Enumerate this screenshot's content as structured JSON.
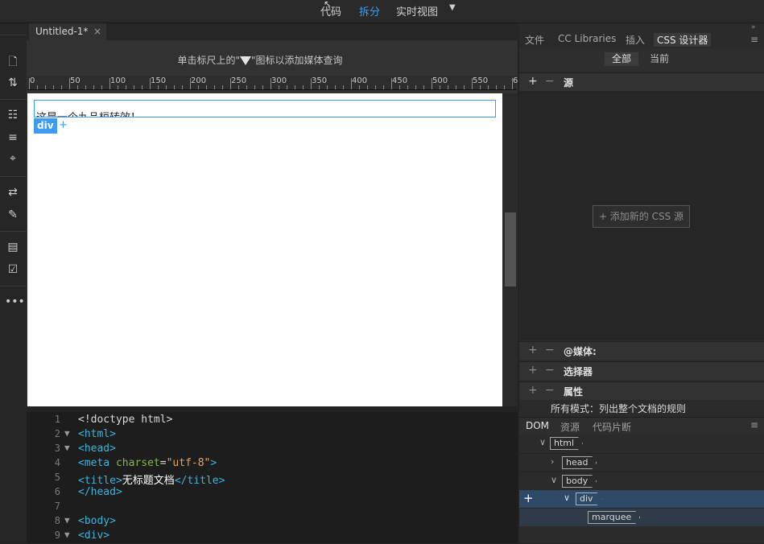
{
  "view_switcher": {
    "code": "代码",
    "split": "拆分",
    "live": "实时视图",
    "dropdown_icon": "caret-down-icon"
  },
  "document": {
    "tab_title": "Untitled-1*",
    "close_glyph": "×"
  },
  "design_view": {
    "media_query_hint_pre": "单击标尺上的\"",
    "media_query_hint_post": "\"图标以添加媒体查询",
    "ruler_labels": [
      "0",
      "50",
      "100",
      "150",
      "200",
      "250",
      "300",
      "350",
      "400",
      "450",
      "500",
      "550",
      "6"
    ],
    "selected_text": "这是一个九品桓转效！",
    "element_tag": "div",
    "add_glyph": "+"
  },
  "code_view": {
    "lines": [
      {
        "n": "1",
        "fold": ""
      },
      {
        "n": "2",
        "fold": "▼"
      },
      {
        "n": "3",
        "fold": "▼"
      },
      {
        "n": "4",
        "fold": ""
      },
      {
        "n": "5",
        "fold": ""
      },
      {
        "n": "6",
        "fold": ""
      },
      {
        "n": "7",
        "fold": ""
      },
      {
        "n": "8",
        "fold": "▼"
      },
      {
        "n": "9",
        "fold": "▼"
      }
    ],
    "doctype": "<!doctype html>",
    "html_open": "<html>",
    "head_open": "<head>",
    "meta_open": "<meta",
    "meta_attr": "charset",
    "meta_eq": "=",
    "meta_val": "\"utf-8\"",
    "meta_close": ">",
    "title_open": "<title>",
    "title_text": "无标题文档",
    "title_close": "</title>",
    "head_close": "</head>",
    "body_open": "<body>",
    "div_open": "<div>"
  },
  "right_panel": {
    "tabs": [
      "文件",
      "CC Libraries",
      "插入",
      "CSS 设计器"
    ],
    "filter_all": "全部",
    "filter_current": "当前",
    "sources_title": "源",
    "add_source_button": "+ 添加新的 CSS 源",
    "media_title": "@媒体:",
    "selectors_title": "选择器",
    "properties_title": "属性",
    "mode_note": "所有模式：列出整个文档的规则",
    "bottom_tabs": [
      "DOM",
      "资源",
      "代码片断"
    ],
    "dom_tree": [
      "html",
      "head",
      "body",
      "div",
      "marquee"
    ]
  }
}
